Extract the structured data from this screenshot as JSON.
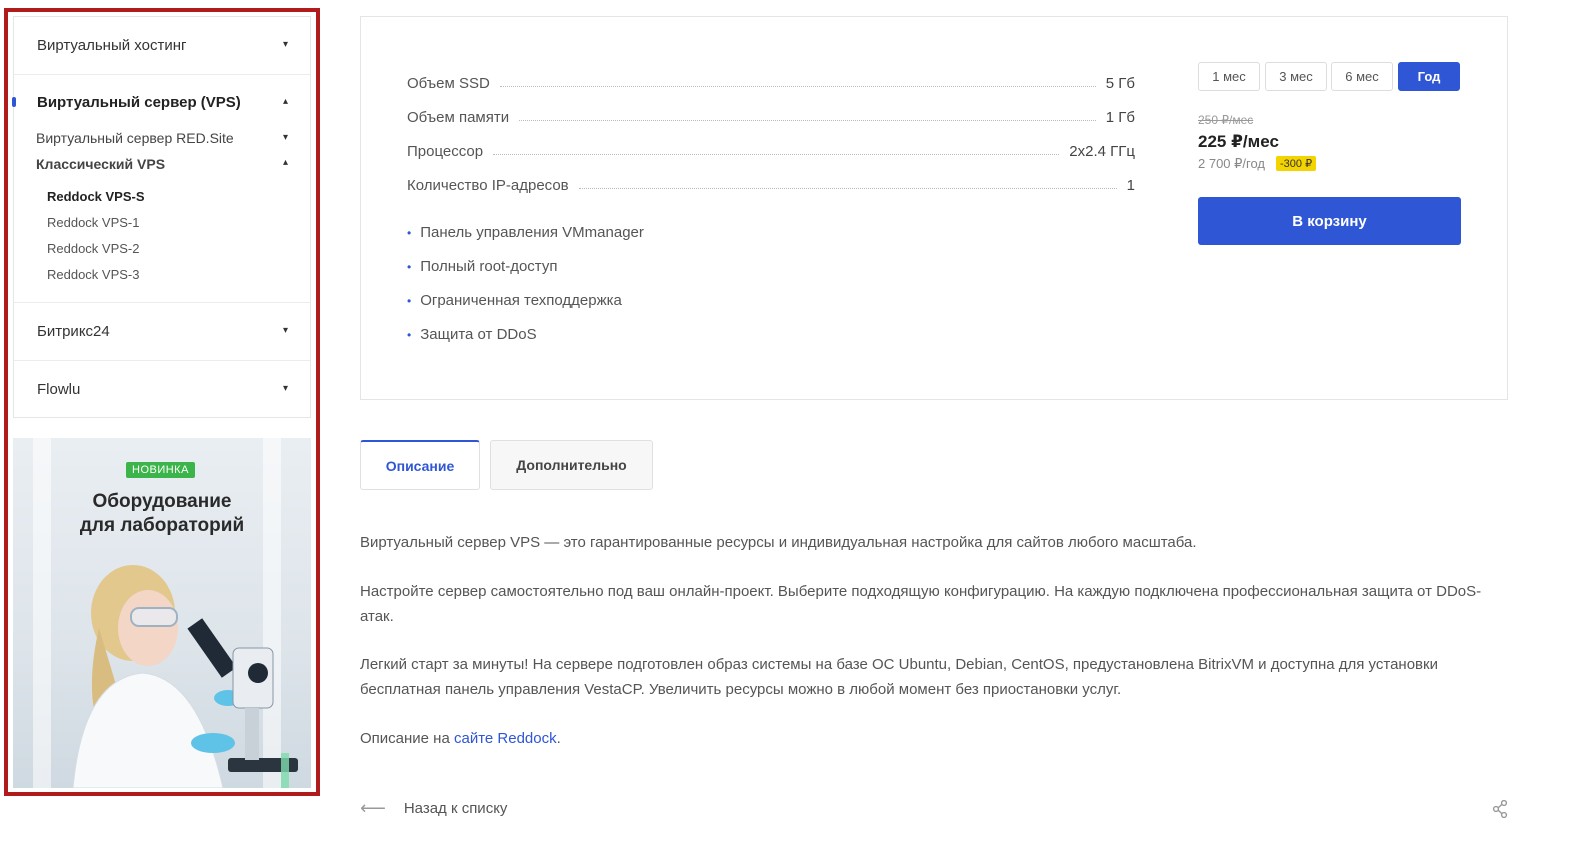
{
  "sidebar": {
    "items": [
      {
        "label": "Виртуальный хостинг"
      },
      {
        "label": "Виртуальный сервер (VPS)"
      },
      {
        "label": "Битрикс24"
      },
      {
        "label": "Flowlu"
      }
    ],
    "vps_sub": [
      {
        "label": "Виртуальный сервер RED.Site"
      },
      {
        "label": "Классический VPS"
      }
    ],
    "classic_sub": [
      {
        "label": "Reddock VPS-S"
      },
      {
        "label": "Reddock VPS-1"
      },
      {
        "label": "Reddock VPS-2"
      },
      {
        "label": "Reddock VPS-3"
      }
    ]
  },
  "banner": {
    "badge": "НОВИНКА",
    "title": "Оборудование\nдля лабораторий"
  },
  "specs": [
    {
      "label": "Объем SSD",
      "value": "5 Гб"
    },
    {
      "label": "Объем памяти",
      "value": "1 Гб"
    },
    {
      "label": "Процессор",
      "value": "2x2.4 ГГц"
    },
    {
      "label": "Количество IP-адресов",
      "value": "1"
    }
  ],
  "features": [
    "Панель управления VMmanager",
    "Полный root-доступ",
    "Ограниченная техподдержка",
    "Защита от DDoS"
  ],
  "periods": [
    "1 мес",
    "3 мес",
    "6 мес",
    "Год"
  ],
  "price": {
    "old": "250 ₽/мес",
    "current": "225 ₽/мес",
    "year": "2 700 ₽/год",
    "discount": "-300 ₽"
  },
  "cart_label": "В корзину",
  "tabs": [
    "Описание",
    "Дополнительно"
  ],
  "description": {
    "p1": "Виртуальный сервер VPS — это гарантированные ресурсы и индивидуальная настройка для сайтов любого масштаба.",
    "p2": "Настройте сервер самостоятельно под ваш онлайн-проект. Выберите подходящую конфигурацию. На каждую подключена профессиональная защита от DDoS-атак.",
    "p3": "Легкий старт за минуты! На сервере подготовлен образ системы на базе ОС Ubuntu, Debian, CentOS, предустановлена BitrixVM и доступна для установки бесплатная панель управления VestaCP. Увеличить ресурсы можно в любой момент без приостановки услуг.",
    "p4_prefix": "Описание на ",
    "p4_link": "сайте Reddock",
    "p4_suffix": "."
  },
  "back_label": "Назад к списку",
  "colors": {
    "accent": "#2f56d4",
    "highlight_border": "#b01c1c",
    "badge_green": "#3bb54a",
    "discount_yellow": "#f3d400"
  }
}
